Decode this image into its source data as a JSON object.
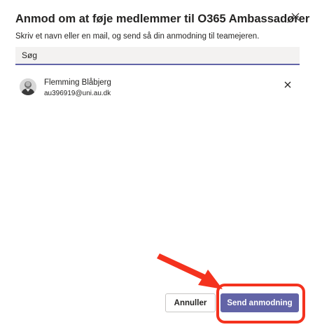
{
  "dialog": {
    "title": "Anmod om at føje medlemmer til O365 Ambassadører",
    "subtitle": "Skriv et navn eller en mail, og send så din anmodning til teamejeren.",
    "close_icon": "close-icon"
  },
  "search": {
    "placeholder": "Søg",
    "value": ""
  },
  "members": [
    {
      "name": "Flemming Blåbjerg",
      "email": "au396919@uni.au.dk",
      "remove_icon": "close-icon"
    }
  ],
  "footer": {
    "cancel_label": "Annuller",
    "send_label": "Send anmodning"
  },
  "annotation": {
    "color": "#f4321e"
  },
  "colors": {
    "accent": "#6264a7",
    "annotation": "#f4321e"
  }
}
